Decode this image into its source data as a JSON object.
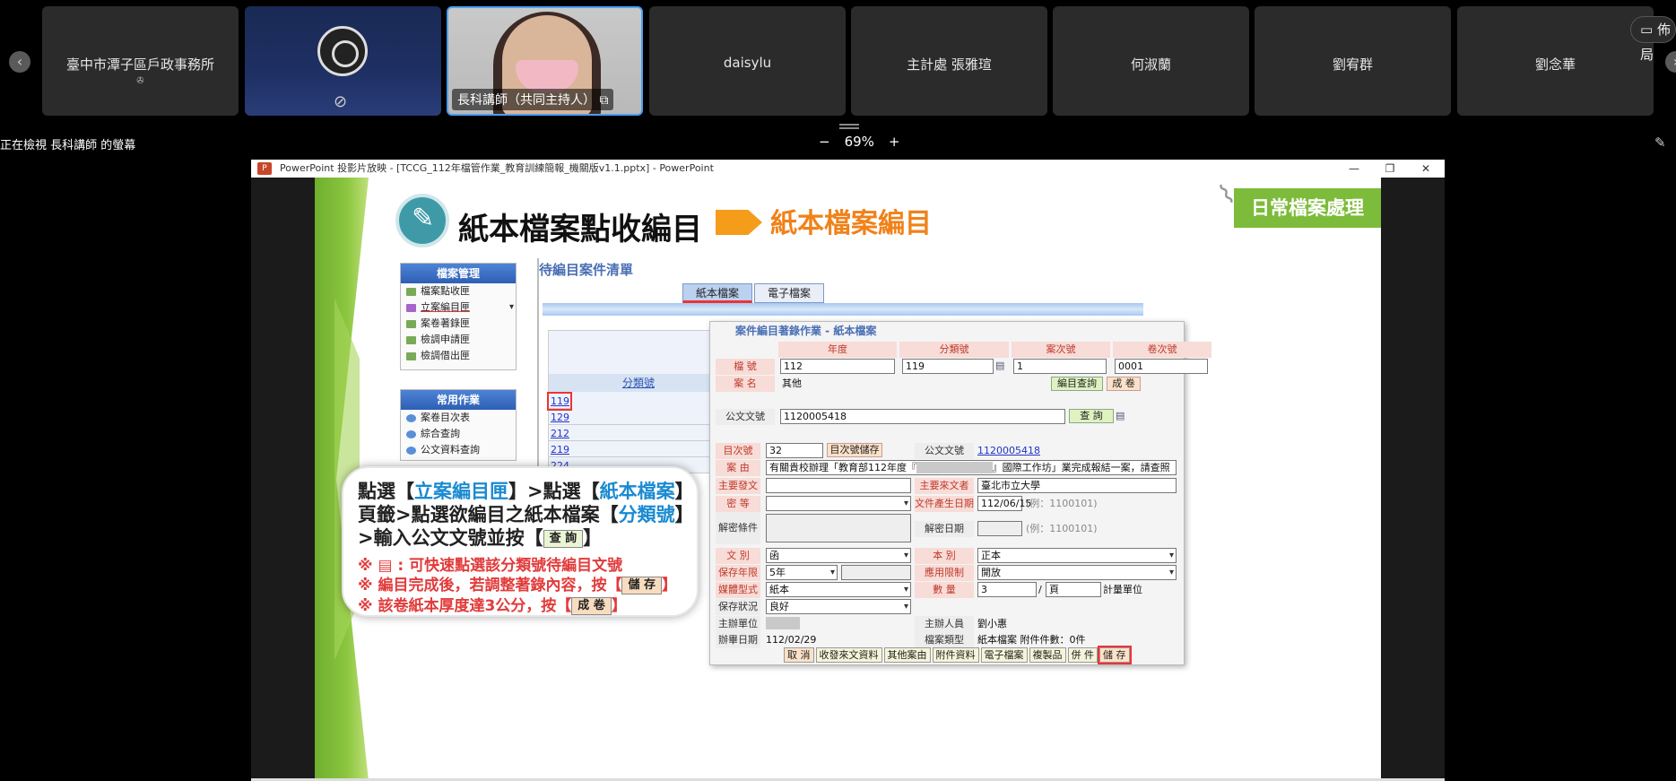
{
  "meeting": {
    "participants": [
      {
        "name": "臺中市潭子區戶政事務所",
        "sub": "✇"
      },
      {
        "name": ""
      },
      {
        "name": "長科講師（共同主持人）"
      },
      {
        "name": "daisylu"
      },
      {
        "name": "主計處 張雅瑄"
      },
      {
        "name": "何淑蘭"
      },
      {
        "name": "劉宥群"
      },
      {
        "name": "劉念華"
      }
    ],
    "layout_label": "佈局",
    "prev_icon": "chevron-left-icon",
    "next_icon": "chevron-right-icon"
  },
  "viewbar": {
    "viewing": "正在檢視 長科講師 的螢幕",
    "zoom_minus": "−",
    "zoom": "69%",
    "zoom_plus": "+"
  },
  "ppt": {
    "window_title": "PowerPoint 投影片放映 - [TCCG_112年檔管作業_教育訓練簡報_機關版v1.1.pptx] - PowerPoint",
    "minimize": "—",
    "restore": "❐",
    "close": "✕"
  },
  "slide": {
    "title": "紙本檔案點收編目",
    "subtitle": "紙本檔案編目",
    "tag": "日常檔案處理",
    "menu1": {
      "head": "檔案管理",
      "items": [
        "檔案點收匣",
        "立案編目匣",
        "案卷著錄匣",
        "檢調申請匣",
        "檢調借出匣"
      ]
    },
    "menu2": {
      "head": "常用作業",
      "items": [
        "案卷目次表",
        "綜合查詢",
        "公文資料查詢"
      ]
    },
    "list_title": "待編目案件清單",
    "tabs": [
      "紙本檔案",
      "電子檔案"
    ],
    "list_header": "分類號",
    "list_rows": [
      "119",
      "129",
      "212",
      "219",
      "224"
    ],
    "bubble": {
      "l1a": "點選【",
      "l1b": "立案編目匣",
      "l1c": "】>點選【",
      "l1d": "紙本檔案",
      "l1e": "】",
      "l2a": "頁籤>點選欲編目之紙本檔案【",
      "l2b": "分類號",
      "l2c": "】",
      "l3a": ">輸入公文文號並按【",
      "l3btn": "查 詢",
      "l3c": "】",
      "n1": "※ ▤ : 可快速點選該分類號待編目文號",
      "n2a": "※ 編目完成後，若調整著錄內容，按【",
      "n2btn": "儲 存",
      "n2c": "】",
      "n3a": "※ 該卷紙本厚度達3公分，按【",
      "n3btn": "成 卷",
      "n3c": "】"
    },
    "form": {
      "title": "案件編目著錄作業 - 紙本檔案",
      "col_heads": [
        "年度",
        "分類號",
        "案次號",
        "卷次號"
      ],
      "l_filenum": "檔 號",
      "v_year": "112",
      "v_class": "119",
      "v_case": "1",
      "v_vol": "0001",
      "l_casename": "案 名",
      "v_casename": "其他",
      "btn_query_catalog": "編目查詢",
      "btn_make_vol": "成 卷",
      "l_docnum": "公文文號",
      "v_docnum": "1120005418",
      "btn_query": "查 詢",
      "l_itemno": "目次號",
      "v_itemno": "32",
      "btn_save_item": "目次號儲存",
      "l_docnum2": "公文文號",
      "v_docnum2": "1120005418",
      "l_reason": "案 由",
      "v_reason": "有關貴校辦理「教育部112年度『",
      "v_reason2": "』國際工作坊」業完成報結一案，請查照",
      "l_sender": "主要發文者",
      "l_recipient": "主要來文者",
      "v_recipient": "臺北市立大學",
      "l_secret": "密 等",
      "l_docdate": "文件產生日期",
      "v_docdate": "112/06/15",
      "hint1": "(例：1100101)",
      "l_declass": "解密條件",
      "l_declassdate": "解密日期",
      "hint2": "(例：1100101)",
      "l_doctype": "文 別",
      "v_doctype": "函",
      "l_copytype": "本 別",
      "v_copytype": "正本",
      "l_keep": "保存年限",
      "v_keep": "5年",
      "l_restrict": "應用限制",
      "v_restrict": "開放",
      "l_media": "媒體型式",
      "v_media": "紙本",
      "l_qty": "數 量",
      "v_qty": "3",
      "v_qty_sep": "/",
      "v_qty_unit": "頁",
      "l_unit": "計量單位",
      "l_status": "保存狀況",
      "v_status": "良好",
      "l_dept": "主辦單位",
      "l_person": "主辦人員",
      "v_person": "劉小惠",
      "l_closedate": "辦畢日期",
      "v_closedate": "112/02/29",
      "l_filetype": "檔案類型",
      "v_filetype": "紙本檔案 附件件數：0件",
      "bottom_buttons": [
        "取 消",
        "收發來文資料",
        "其他案由",
        "附件資料",
        "電子檔案",
        "複製品",
        "併 件",
        "儲 存"
      ]
    }
  }
}
